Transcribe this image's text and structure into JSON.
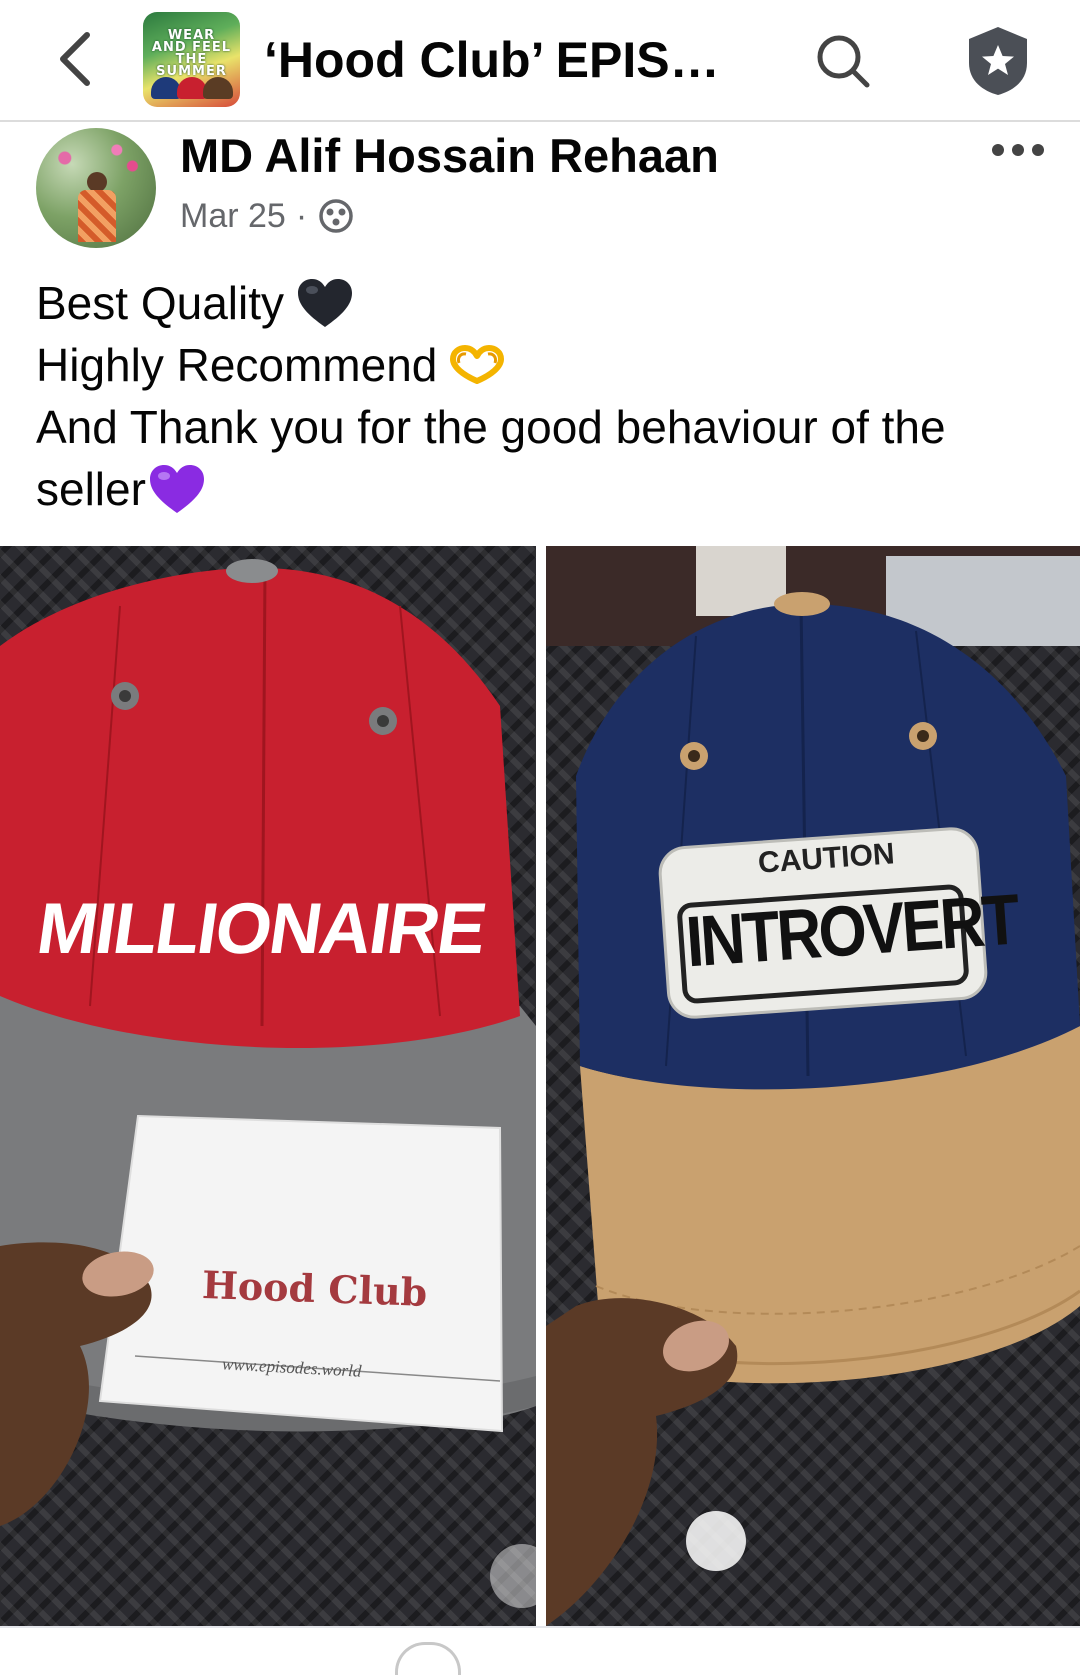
{
  "header": {
    "back_icon": "chevron-left-icon",
    "group_thumb_text": "WEAR AND FEEL THE SUMMER",
    "group_title": "‘Hood Club’ EPISODES",
    "search_icon": "search-icon",
    "shield_icon": "shield-star-icon"
  },
  "post": {
    "author": "MD Alif Hossain Rehaan",
    "date": "Mar 25",
    "separator": "·",
    "privacy_icon": "globe-icon",
    "more_icon": "more-dots-icon",
    "lines": [
      {
        "text": "Best Quality",
        "emoji": "black-heart"
      },
      {
        "text": "Highly Recommend",
        "emoji": "heart-hands"
      },
      {
        "text": "And Thank you for the good behaviour of the",
        "emoji": ""
      },
      {
        "text": "seller",
        "emoji": "purple-heart"
      }
    ]
  },
  "photos": [
    {
      "cap_text": "MILLIONAIRE",
      "card_text": "Hood Club",
      "card_url": "www.episodes.world",
      "colors": {
        "crown": "#c8202f",
        "brim": "#7a7b7d"
      }
    },
    {
      "patch_top": "CAUTION",
      "patch_main": "INTROVERT",
      "colors": {
        "crown": "#1d2f63",
        "brim": "#c9a16f"
      }
    }
  ]
}
